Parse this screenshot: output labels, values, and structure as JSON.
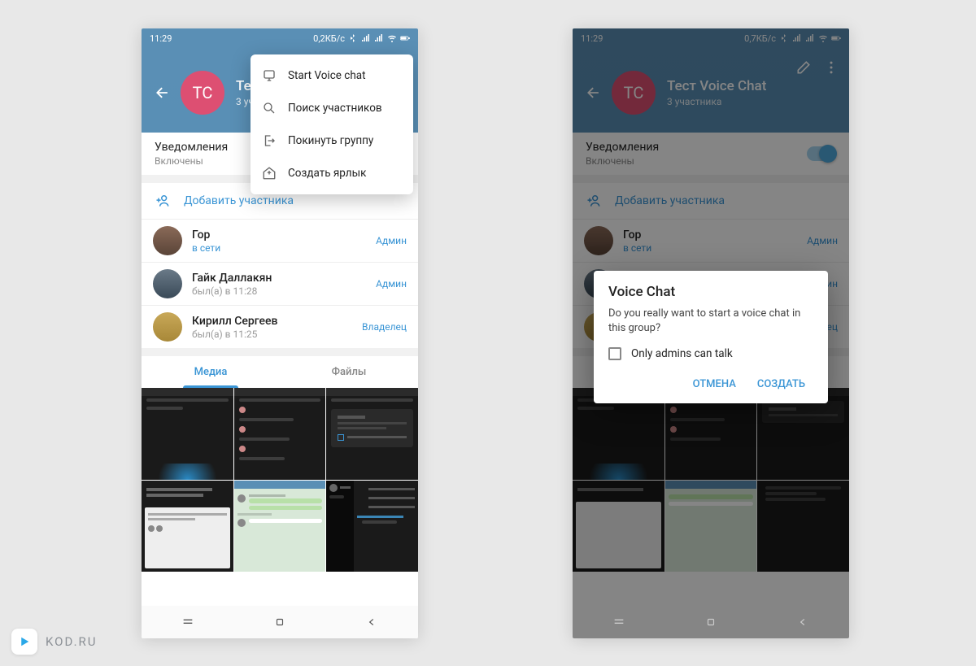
{
  "colors": {
    "accent": "#3a95d5",
    "headerBg": "#598fb5",
    "avatarBg": "#dd4f72",
    "toggleTrack": "#a8d5ef",
    "toggleThumb": "#4fa9dd"
  },
  "left": {
    "statusBar": {
      "time": "11:29",
      "dataRate": "0,2КБ/с"
    },
    "header": {
      "avatarInitials": "ТС",
      "title": "Тест Voice Chat",
      "subtitle": "3 участника"
    },
    "dropdown": {
      "items": [
        {
          "icon": "voice-chat-icon",
          "label": "Start Voice chat"
        },
        {
          "icon": "search-icon",
          "label": "Поиск участников"
        },
        {
          "icon": "leave-icon",
          "label": "Покинуть группу"
        },
        {
          "icon": "shortcut-icon",
          "label": "Создать ярлык"
        }
      ]
    },
    "notifications": {
      "label": "Уведомления",
      "value": "Включены",
      "toggleOn": true
    },
    "addMember": {
      "label": "Добавить участника"
    },
    "members": [
      {
        "name": "Гор",
        "status": "в сети",
        "statusOnline": true,
        "role": "Админ"
      },
      {
        "name": "Гайк Даллакян",
        "status": "был(а) в 11:28",
        "statusOnline": false,
        "role": "Админ"
      },
      {
        "name": "Кирилл Сергеев",
        "status": "был(а) в 11:25",
        "statusOnline": false,
        "role": "Владелец"
      }
    ],
    "tabs": {
      "media": "Медиа",
      "files": "Файлы",
      "active": "media"
    }
  },
  "right": {
    "statusBar": {
      "time": "11:29",
      "dataRate": "0,7КБ/с"
    },
    "header": {
      "avatarInitials": "ТС",
      "title": "Тест Voice Chat",
      "subtitle": "3 участника"
    },
    "notifications": {
      "label": "Уведомления",
      "value": "Включены",
      "toggleOn": true
    },
    "addMember": {
      "label": "Добавить участника"
    },
    "members": [
      {
        "name": "Гор",
        "status": "в сети",
        "statusOnline": true,
        "role": "Админ"
      },
      {
        "name": "Гайк Даллакян",
        "status": "был(а) в 11:28",
        "statusOnline": false,
        "role": "Админ"
      },
      {
        "name": "Кирилл Сергеев",
        "status": "был(а) в 11:25",
        "statusOnline": false,
        "role": "Владелец"
      }
    ],
    "tabs": {
      "media": "Медиа",
      "files": "Файлы",
      "active": "media"
    },
    "dialog": {
      "title": "Voice Chat",
      "message": "Do you really want to start a voice chat in this group?",
      "checkbox": "Only admins can talk",
      "cancel": "ОТМЕНА",
      "confirm": "СОЗДАТЬ"
    }
  },
  "watermark": {
    "text": "KOD.RU"
  }
}
